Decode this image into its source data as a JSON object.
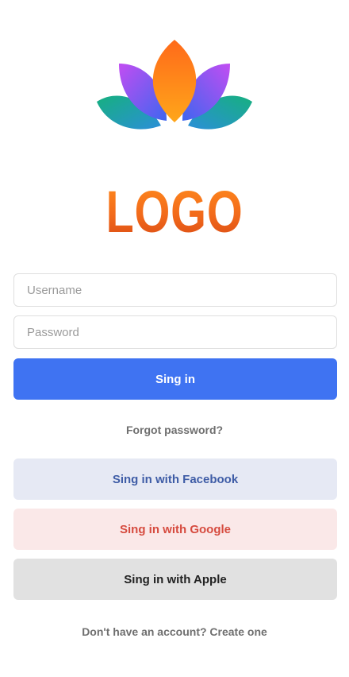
{
  "logo": {
    "text": "LOGO",
    "colors": {
      "petal_purple": "#b24ff0",
      "petal_blue": "#4e63f0",
      "petal_green": "#18b589",
      "petal_orange": "#ff7a12",
      "text_orange": "#f26a1b"
    }
  },
  "form": {
    "username_placeholder": "Username",
    "password_placeholder": "Password",
    "signin_label": "Sing in"
  },
  "links": {
    "forgot_password": "Forgot password?",
    "create_account": "Don't have an account? Create one"
  },
  "social": {
    "facebook_label": "Sing in with Facebook",
    "google_label": "Sing in with Google",
    "apple_label": "Sing in with Apple"
  },
  "theme": {
    "primary": "#3f73f2",
    "facebook_bg": "#e6e9f4",
    "facebook_text": "#3e5ca6",
    "google_bg": "#fae8e8",
    "google_text": "#d64b3f",
    "apple_bg": "#e1e1e1",
    "apple_text": "#222222"
  }
}
